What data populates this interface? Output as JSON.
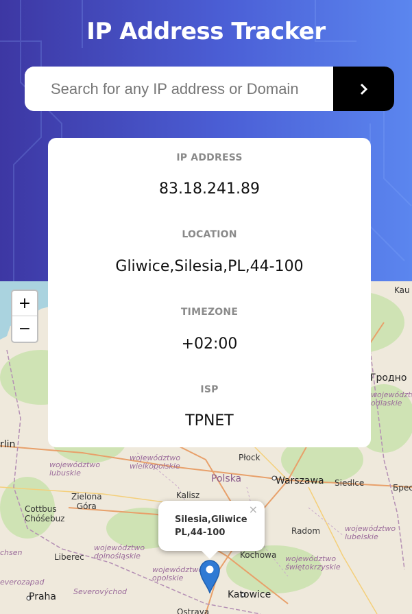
{
  "header": {
    "title": "IP Address Tracker",
    "search": {
      "placeholder": "Search for any IP address or Domain",
      "value": ""
    }
  },
  "info": {
    "ip_label": "IP ADDRESS",
    "ip_value": "83.18.241.89",
    "location_label": "LOCATION",
    "location_value": "Gliwice,Silesia,PL,44-100",
    "timezone_label": "TIMEZONE",
    "timezone_value": "+02:00",
    "isp_label": "ISP",
    "isp_value": "TPNET"
  },
  "map": {
    "zoom_in": "+",
    "zoom_out": "−",
    "popup_text": "Silesia,Gliwice PL,44-100",
    "popup_close": "×",
    "labels": {
      "kau": "Kau",
      "grodno": "Гродно",
      "wojewodztwo_podlaskie_fragment": "województwo\nodlaskie",
      "rlin": "rlin",
      "wojewodztwo_lubuskie": "województwo\nlubuskie",
      "wojewodztwo_wielkopolskie": "województwo\nwielkopolskie",
      "plock": "Płock",
      "polska": "Polska",
      "warszawa": "Warszawa",
      "siedlce": "Siedlce",
      "brest": "Брес",
      "zielona_gora": "Zielona\nGóra",
      "kalisz": "Kalisz",
      "cottbus": "Cottbus\nChóśebuz",
      "radom": "Radom",
      "wojewodztwo_lubelskie": "województwo\nlubelskie",
      "chsen": "chsen",
      "liberec": "Liberec",
      "wojewodztwo_dolnoslaskie": "województwo\ndolnośląskie",
      "kochowa": "Kochowa",
      "wojewodztwo_swietokrzyskie": "województwo\nświętokrzyskie",
      "wojewodztwo_opolskie": "województwo\nopolskie",
      "severozapad": "everozapad",
      "praha": "Praha",
      "severovychod": "Severovýchod",
      "katowice": "Katowice",
      "ostrava": "Ostrava"
    }
  }
}
